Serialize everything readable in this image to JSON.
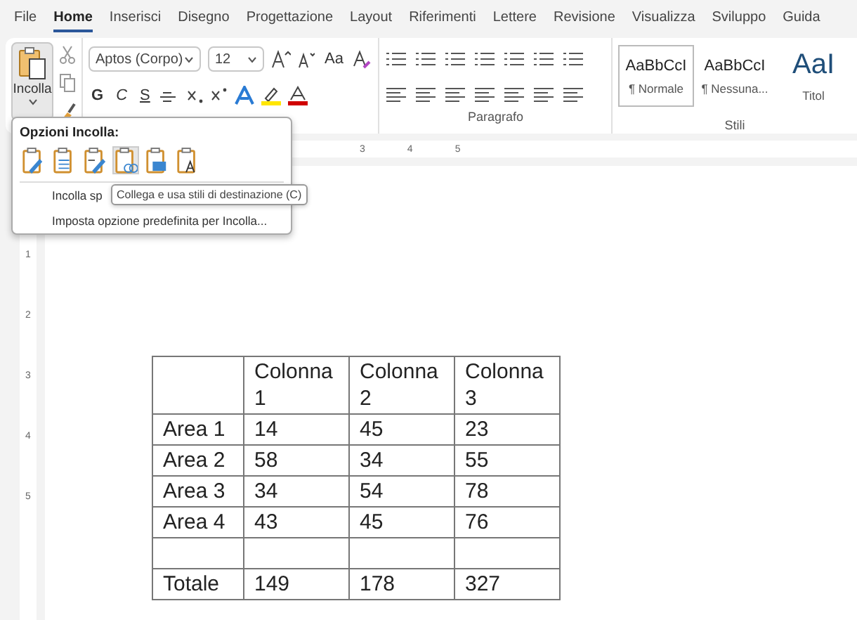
{
  "menu_tabs": [
    {
      "label": "File",
      "selected": false
    },
    {
      "label": "Home",
      "selected": true
    },
    {
      "label": "Inserisci",
      "selected": false
    },
    {
      "label": "Disegno",
      "selected": false
    },
    {
      "label": "Progettazione",
      "selected": false
    },
    {
      "label": "Layout",
      "selected": false
    },
    {
      "label": "Riferimenti",
      "selected": false
    },
    {
      "label": "Lettere",
      "selected": false
    },
    {
      "label": "Revisione",
      "selected": false
    },
    {
      "label": "Visualizza",
      "selected": false
    },
    {
      "label": "Sviluppo",
      "selected": false
    },
    {
      "label": "Guida",
      "selected": false
    }
  ],
  "clipboard": {
    "paste_label": "Incolla"
  },
  "font": {
    "font_name": "Aptos (Corpo)",
    "font_size": "12",
    "change_case": "Aa",
    "bold": "G",
    "italic": "C",
    "underline": "S"
  },
  "paragraph": {
    "group_label": "Paragrafo"
  },
  "styles": {
    "group_label": "Stili",
    "items": [
      {
        "preview": "AaBbCcI",
        "name": "¶ Normale",
        "selected": true
      },
      {
        "preview": "AaBbCcI",
        "name": "¶ Nessuna...",
        "selected": false
      },
      {
        "preview": "AaI",
        "name": "Titol",
        "selected": false
      }
    ]
  },
  "ruler": {
    "numbers": [
      "3",
      "4",
      "5"
    ]
  },
  "vertical_ruler": {
    "numbers": [
      "1",
      "2",
      "3",
      "4",
      "5"
    ]
  },
  "paste_popup": {
    "title": "Opzioni Incolla:",
    "options": [
      {
        "selected": false
      },
      {
        "selected": false
      },
      {
        "selected": false
      },
      {
        "selected": true
      },
      {
        "selected": false
      },
      {
        "selected": false
      }
    ],
    "items": [
      "Incolla sp",
      "Imposta opzione predefinita per Incolla..."
    ],
    "tooltip": "Collega e usa stili di destinazione (C)"
  },
  "table": {
    "header": [
      "Colonna 1",
      "Colonna 2",
      "Colonna 3"
    ],
    "rows": [
      [
        "Area 1",
        "14",
        "45",
        "23"
      ],
      [
        "Area 2",
        "58",
        "34",
        "55"
      ],
      [
        "Area 3",
        "34",
        "54",
        "78"
      ],
      [
        "Area 4",
        "43",
        "45",
        "76"
      ],
      [
        "",
        "",
        "",
        ""
      ],
      [
        "Totale",
        "149",
        "178",
        "327"
      ]
    ]
  }
}
